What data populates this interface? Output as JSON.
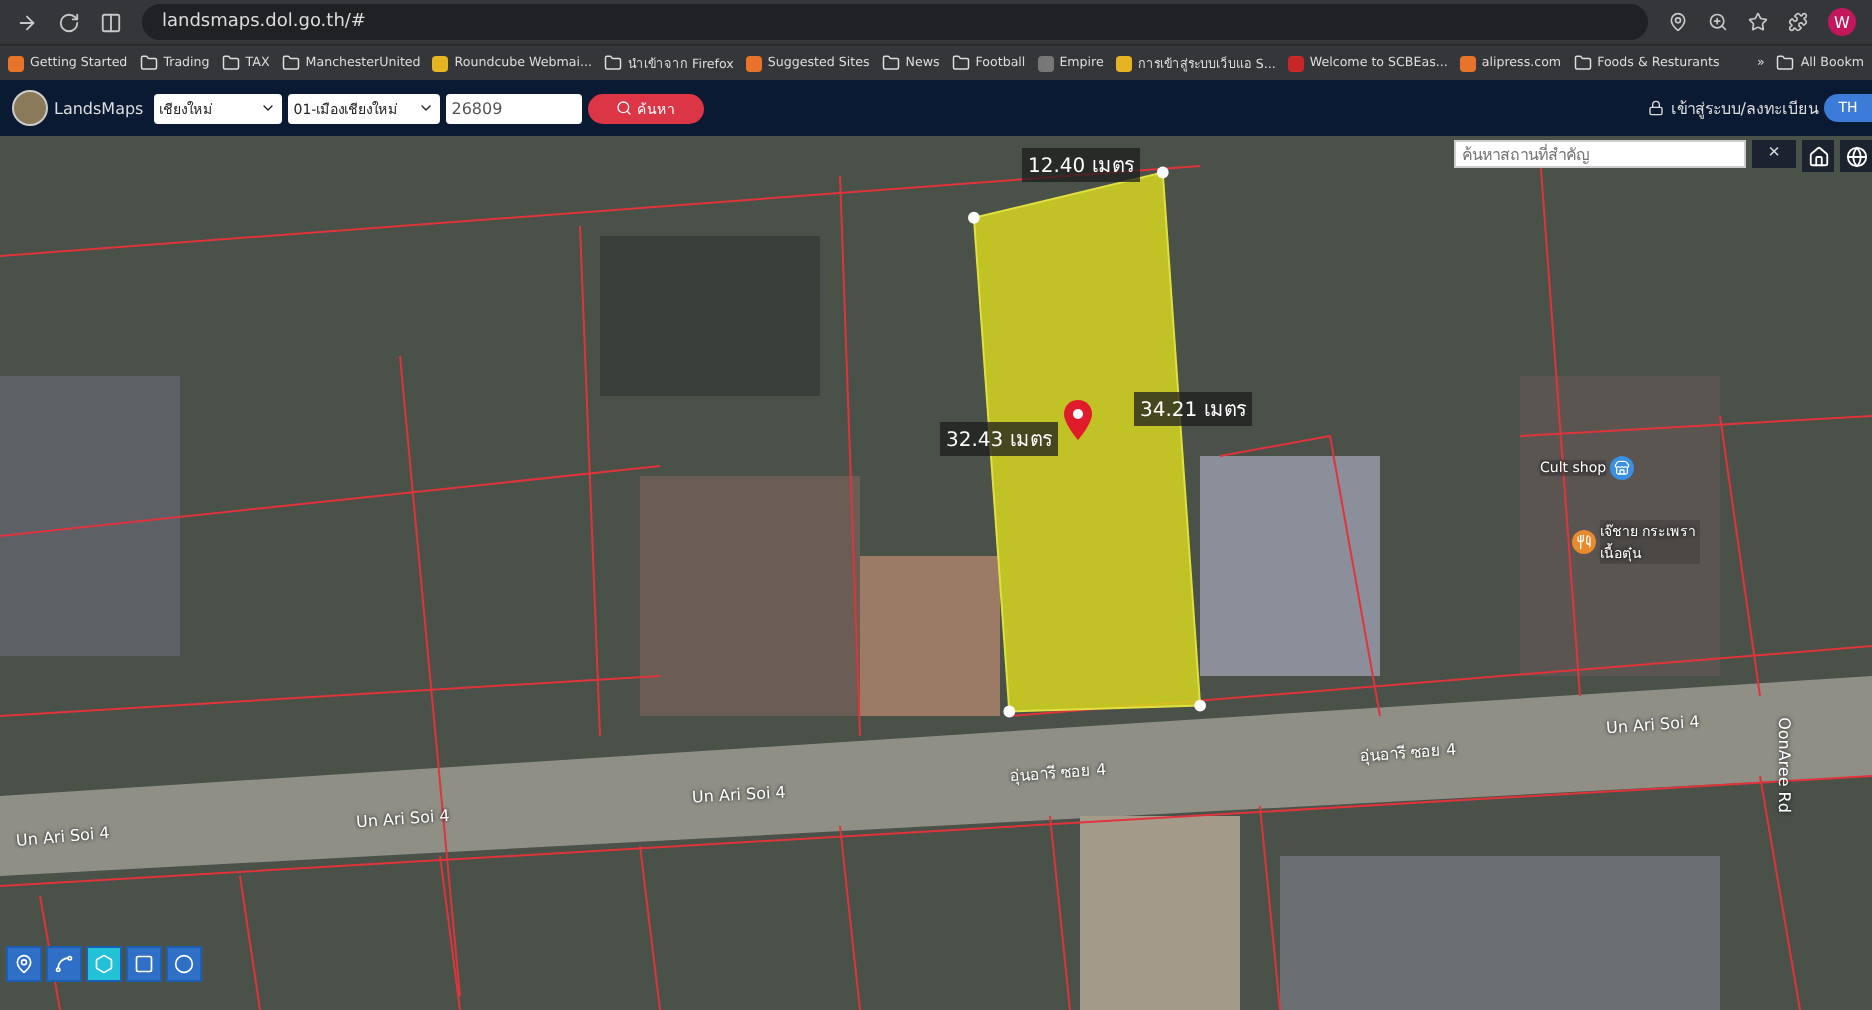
{
  "browser": {
    "url": "landsmaps.dol.go.th/#",
    "profile_initial": "W"
  },
  "bookmarks": [
    {
      "label": "Getting Started",
      "kind": "site"
    },
    {
      "label": "Trading",
      "kind": "folder"
    },
    {
      "label": "TAX",
      "kind": "folder"
    },
    {
      "label": "ManchesterUnited",
      "kind": "folder"
    },
    {
      "label": "Roundcube Webmai...",
      "kind": "site"
    },
    {
      "label": "นำเข้าจาก Firefox",
      "kind": "folder"
    },
    {
      "label": "Suggested Sites",
      "kind": "site"
    },
    {
      "label": "News",
      "kind": "folder"
    },
    {
      "label": "Football",
      "kind": "folder"
    },
    {
      "label": "Empire",
      "kind": "site"
    },
    {
      "label": "การเข้าสู่ระบบเว็บแอ S...",
      "kind": "site"
    },
    {
      "label": "Welcome to SCBEas...",
      "kind": "site"
    },
    {
      "label": "alipress.com",
      "kind": "site"
    },
    {
      "label": "Foods & Resturants",
      "kind": "folder"
    }
  ],
  "bookmarks_overflow": "»",
  "all_bookmarks": "All Bookm",
  "app": {
    "logo_text": "LandsMaps",
    "province": "เชียงใหม่",
    "district": "01-เมืองเชียงใหม่",
    "parcel_number": "26809",
    "search_button": "ค้นหา",
    "login": "เข้าสู่ระบบ/ลงทะเบียน",
    "language": "TH"
  },
  "map": {
    "place_search": {
      "placeholder": "ค้นหาสถานที่สำคัญ",
      "clear": "×"
    },
    "measurements": [
      "12.40 เมตร",
      "32.43 เมตร",
      "34.21 เมตร"
    ],
    "places": [
      {
        "name": "Cult shop",
        "kind": "shop"
      },
      {
        "name": "เจ๊ชาย กระเพรา เนื้อตุ๋น",
        "kind": "food"
      }
    ],
    "roads": [
      "Un Ari Soi 4",
      "Un Ari Soi 4",
      "Un Ari Soi 4",
      "อุ่นอารี ซอย 4",
      "อุ่นอารี ซอย 4",
      "Un Ari Soi 4",
      "OonAree Rd"
    ],
    "tools": [
      {
        "kind": "marker",
        "selected": false
      },
      {
        "kind": "line",
        "selected": false
      },
      {
        "kind": "polygon",
        "selected": true
      },
      {
        "kind": "rectangle",
        "selected": false
      },
      {
        "kind": "circle",
        "selected": false
      }
    ]
  }
}
